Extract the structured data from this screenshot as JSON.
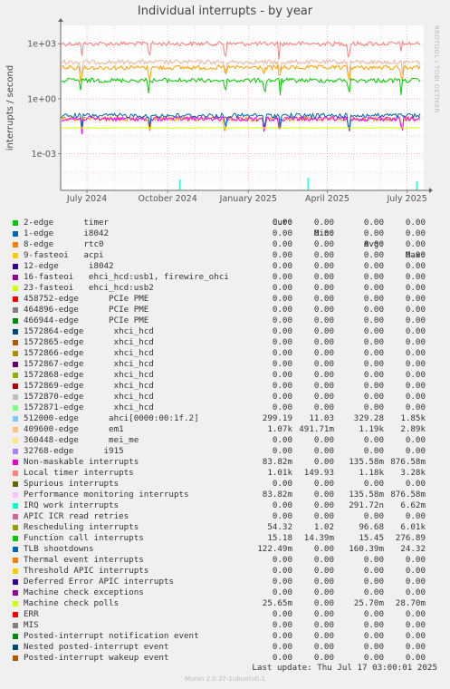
{
  "chart_data": {
    "type": "line",
    "title": "Individual interrupts - by year",
    "ylabel": "interrupts / second",
    "yscale": "log",
    "ylim": [
      1e-05,
      10000
    ],
    "yticks": [
      {
        "v": 1000,
        "label": "1e+03"
      },
      {
        "v": 1,
        "label": "1e+00"
      },
      {
        "v": 0.001,
        "label": "1e-03"
      }
    ],
    "xrange": [
      "2024-06-01",
      "2025-07-20"
    ],
    "xticks": [
      {
        "date": "2024-07-01",
        "label": "July 2024"
      },
      {
        "date": "2024-10-01",
        "label": "October 2024"
      },
      {
        "date": "2025-01-01",
        "label": "January 2025"
      },
      {
        "date": "2025-04-01",
        "label": "April 2025"
      },
      {
        "date": "2025-07-01",
        "label": "July 2025"
      }
    ],
    "grid": true,
    "series": [
      {
        "name": "Local timer interrupts",
        "color": "#FF7D7D",
        "level": 1000
      },
      {
        "name": "Rescheduling interrupts",
        "color": "#E8B8A0",
        "level": 100
      },
      {
        "name": "409600-edge      em1",
        "color": "#FFA200",
        "level": 50
      },
      {
        "name": "Function call interrupts",
        "color": "#00CC00",
        "level": 10
      },
      {
        "name": "Performance monitoring interrupts",
        "color": "#EA8F00",
        "level": 0.08
      },
      {
        "name": "Non-maskable interrupts",
        "color": "#FF00FF",
        "level": 0.08
      },
      {
        "name": "TLB shootdowns",
        "color": "#0066B3",
        "level": 0.12
      },
      {
        "name": "Machine check polls",
        "color": "#CCFF00",
        "level": 0.0257
      }
    ]
  },
  "legend_headers": {
    "cur": "Cur:",
    "min": "Min:",
    "avg": "Avg:",
    "max": "Max:"
  },
  "legend": [
    {
      "label": "2-edge      timer",
      "color": "#00CC00",
      "cur": "0.00",
      "min": "0.00",
      "avg": "0.00",
      "max": "0.00"
    },
    {
      "label": "1-edge      i8042",
      "color": "#0066B3",
      "cur": "0.00",
      "min": "0.00",
      "avg": "0.00",
      "max": "0.00"
    },
    {
      "label": "8-edge      rtc0",
      "color": "#FF8000",
      "cur": "0.00",
      "min": "0.00",
      "avg": "0.00",
      "max": "0.00"
    },
    {
      "label": "9-fasteoi   acpi",
      "color": "#FFCC00",
      "cur": "0.00",
      "min": "0.00",
      "avg": "0.00",
      "max": "0.00"
    },
    {
      "label": "12-edge      i8042",
      "color": "#330099",
      "cur": "0.00",
      "min": "0.00",
      "avg": "0.00",
      "max": "0.00"
    },
    {
      "label": "16-fasteoi   ehci_hcd:usb1, firewire_ohci",
      "color": "#990099",
      "cur": "0.00",
      "min": "0.00",
      "avg": "0.00",
      "max": "0.00"
    },
    {
      "label": "23-fasteoi   ehci_hcd:usb2",
      "color": "#CCFF00",
      "cur": "0.00",
      "min": "0.00",
      "avg": "0.00",
      "max": "0.00"
    },
    {
      "label": "458752-edge      PCIe PME",
      "color": "#FF0000",
      "cur": "0.00",
      "min": "0.00",
      "avg": "0.00",
      "max": "0.00"
    },
    {
      "label": "464896-edge      PCIe PME",
      "color": "#808080",
      "cur": "0.00",
      "min": "0.00",
      "avg": "0.00",
      "max": "0.00"
    },
    {
      "label": "466944-edge      PCIe PME",
      "color": "#008F00",
      "cur": "0.00",
      "min": "0.00",
      "avg": "0.00",
      "max": "0.00"
    },
    {
      "label": "1572864-edge      xhci_hcd",
      "color": "#00487D",
      "cur": "0.00",
      "min": "0.00",
      "avg": "0.00",
      "max": "0.00"
    },
    {
      "label": "1572865-edge      xhci_hcd",
      "color": "#B35A00",
      "cur": "0.00",
      "min": "0.00",
      "avg": "0.00",
      "max": "0.00"
    },
    {
      "label": "1572866-edge      xhci_hcd",
      "color": "#B38F00",
      "cur": "0.00",
      "min": "0.00",
      "avg": "0.00",
      "max": "0.00"
    },
    {
      "label": "1572867-edge      xhci_hcd",
      "color": "#6B006B",
      "cur": "0.00",
      "min": "0.00",
      "avg": "0.00",
      "max": "0.00"
    },
    {
      "label": "1572868-edge      xhci_hcd",
      "color": "#8FB300",
      "cur": "0.00",
      "min": "0.00",
      "avg": "0.00",
      "max": "0.00"
    },
    {
      "label": "1572869-edge      xhci_hcd",
      "color": "#B30000",
      "cur": "0.00",
      "min": "0.00",
      "avg": "0.00",
      "max": "0.00"
    },
    {
      "label": "1572870-edge      xhci_hcd",
      "color": "#BEBEBE",
      "cur": "0.00",
      "min": "0.00",
      "avg": "0.00",
      "max": "0.00"
    },
    {
      "label": "1572871-edge      xhci_hcd",
      "color": "#80FF80",
      "cur": "0.00",
      "min": "0.00",
      "avg": "0.00",
      "max": "0.00"
    },
    {
      "label": "512000-edge      ahci[0000:00:1f.2]",
      "color": "#80C9FF",
      "cur": "299.19",
      "min": "11.03",
      "avg": "329.28",
      "max": "1.85k"
    },
    {
      "label": "409600-edge      em1",
      "color": "#FFC080",
      "cur": "1.07k",
      "min": "491.71m",
      "avg": "1.19k",
      "max": "2.89k"
    },
    {
      "label": "360448-edge      mei_me",
      "color": "#FFE680",
      "cur": "0.00",
      "min": "0.00",
      "avg": "0.00",
      "max": "0.00"
    },
    {
      "label": "32768-edge      i915",
      "color": "#AA80FF",
      "cur": "0.00",
      "min": "0.00",
      "avg": "0.00",
      "max": "0.00"
    },
    {
      "label": "Non-maskable interrupts",
      "color": "#EE00CC",
      "cur": "83.82m",
      "min": "0.00",
      "avg": "135.58m",
      "max": "876.58m"
    },
    {
      "label": "Local timer interrupts",
      "color": "#FF8080",
      "cur": "1.01k",
      "min": "149.93",
      "avg": "1.18k",
      "max": "3.28k"
    },
    {
      "label": "Spurious interrupts",
      "color": "#666600",
      "cur": "0.00",
      "min": "0.00",
      "avg": "0.00",
      "max": "0.00"
    },
    {
      "label": "Performance monitoring interrupts",
      "color": "#FFBFFF",
      "cur": "83.82m",
      "min": "0.00",
      "avg": "135.58m",
      "max": "876.58m"
    },
    {
      "label": "IRQ work interrupts",
      "color": "#00FFCC",
      "cur": "0.00",
      "min": "0.00",
      "avg": "291.72n",
      "max": "6.62m"
    },
    {
      "label": "APIC ICR read retries",
      "color": "#CC6699",
      "cur": "0.00",
      "min": "0.00",
      "avg": "0.00",
      "max": "0.00"
    },
    {
      "label": "Rescheduling interrupts",
      "color": "#999900",
      "cur": "54.32",
      "min": "1.02",
      "avg": "96.68",
      "max": "6.01k"
    },
    {
      "label": "Function call interrupts",
      "color": "#00CC00",
      "cur": "15.18",
      "min": "14.39m",
      "avg": "15.45",
      "max": "276.89"
    },
    {
      "label": "TLB shootdowns",
      "color": "#0066B3",
      "cur": "122.49m",
      "min": "0.00",
      "avg": "160.39m",
      "max": "24.32"
    },
    {
      "label": "Thermal event interrupts",
      "color": "#FF8000",
      "cur": "0.00",
      "min": "0.00",
      "avg": "0.00",
      "max": "0.00"
    },
    {
      "label": "Threshold APIC interrupts",
      "color": "#FFCC00",
      "cur": "0.00",
      "min": "0.00",
      "avg": "0.00",
      "max": "0.00"
    },
    {
      "label": "Deferred Error APIC interrupts",
      "color": "#330099",
      "cur": "0.00",
      "min": "0.00",
      "avg": "0.00",
      "max": "0.00"
    },
    {
      "label": "Machine check exceptions",
      "color": "#990099",
      "cur": "0.00",
      "min": "0.00",
      "avg": "0.00",
      "max": "0.00"
    },
    {
      "label": "Machine check polls",
      "color": "#CCFF00",
      "cur": "25.65m",
      "min": "0.00",
      "avg": "25.70m",
      "max": "28.70m"
    },
    {
      "label": "ERR",
      "color": "#FF0000",
      "cur": "0.00",
      "min": "0.00",
      "avg": "0.00",
      "max": "0.00"
    },
    {
      "label": "MIS",
      "color": "#808080",
      "cur": "0.00",
      "min": "0.00",
      "avg": "0.00",
      "max": "0.00"
    },
    {
      "label": "Posted-interrupt notification event",
      "color": "#008F00",
      "cur": "0.00",
      "min": "0.00",
      "avg": "0.00",
      "max": "0.00"
    },
    {
      "label": "Nested posted-interrupt event",
      "color": "#00487D",
      "cur": "0.00",
      "min": "0.00",
      "avg": "0.00",
      "max": "0.00"
    },
    {
      "label": "Posted-interrupt wakeup event",
      "color": "#B35A00",
      "cur": "0.00",
      "min": "0.00",
      "avg": "0.00",
      "max": "0.00"
    }
  ],
  "last_update": "Last update: Thu Jul 17 03:00:01 2025",
  "side_label": "RRDTOOL / TOBI OETIKER",
  "footer": "Munin 2.0.37-1ubuntu0.1"
}
